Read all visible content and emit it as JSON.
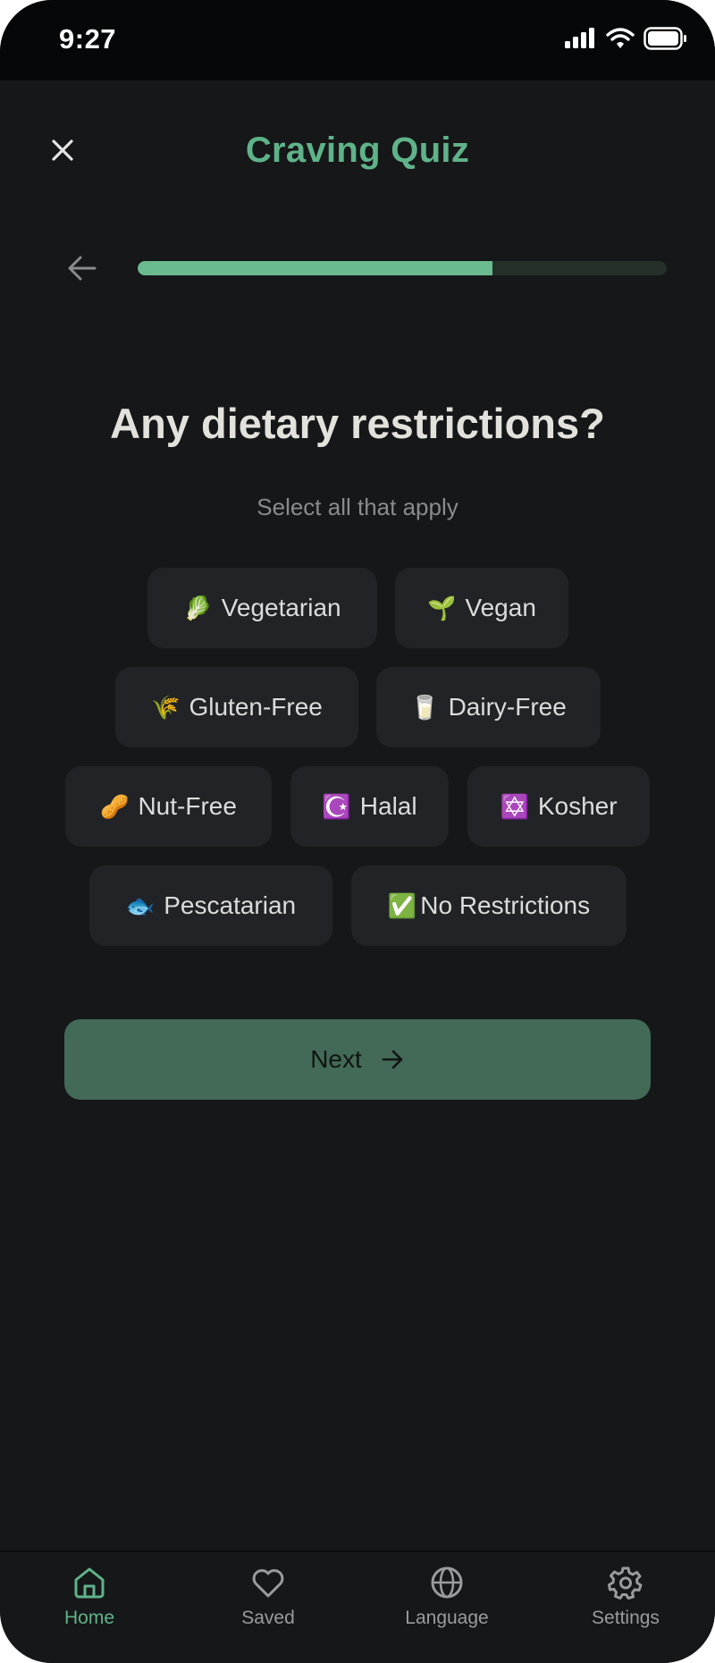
{
  "status_bar": {
    "time": "9:27"
  },
  "header": {
    "title": "Craving Quiz"
  },
  "progress": {
    "fraction": 0.67
  },
  "question": {
    "title": "Any dietary restrictions?",
    "subtitle": "Select all that apply"
  },
  "options": [
    {
      "emoji": "🥬",
      "label": "Vegetarian"
    },
    {
      "emoji": "🌱",
      "label": "Vegan"
    },
    {
      "emoji": "🌾",
      "label": "Gluten-Free"
    },
    {
      "emoji": "🥛",
      "label": "Dairy-Free"
    },
    {
      "emoji": "🥜",
      "label": "Nut-Free"
    },
    {
      "emoji": "☪️",
      "label": "Halal"
    },
    {
      "emoji": "✡️",
      "label": "Kosher"
    },
    {
      "emoji": "🐟",
      "label": "Pescatarian"
    },
    {
      "emoji": "✅",
      "label": "No Restrictions"
    }
  ],
  "next_button": {
    "label": "Next"
  },
  "tabs": [
    {
      "label": "Home",
      "icon": "home-icon",
      "active": true
    },
    {
      "label": "Saved",
      "icon": "heart-icon",
      "active": false
    },
    {
      "label": "Language",
      "icon": "globe-icon",
      "active": false
    },
    {
      "label": "Settings",
      "icon": "gear-icon",
      "active": false
    }
  ],
  "colors": {
    "accent": "#5fb389",
    "background": "#161719",
    "chip": "#222326",
    "button": "#426a57"
  }
}
